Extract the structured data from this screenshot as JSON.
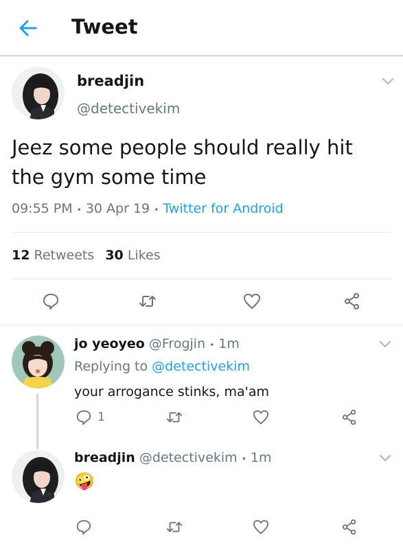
{
  "header": {
    "title": "Tweet"
  },
  "main_tweet": {
    "display_name": "breadjin",
    "handle": "@detectivekim",
    "text_line1": "Jeez some people should really hit",
    "text_line2": "the gym some time",
    "time": "09:55 PM",
    "date": "30 Apr 19",
    "sep": "•",
    "source": "Twitter for Android",
    "retweets_count": "12",
    "retweets_label": "Retweets",
    "likes_count": "30",
    "likes_label": "Likes"
  },
  "replies": [
    {
      "display_name": "jo yeoyeo",
      "handle": "@Frogjin",
      "sep": "•",
      "time": "1m",
      "replying_prefix": "Replying to",
      "replying_handle": "@detectivekim",
      "text": "your arrogance stinks, ma'am",
      "reply_count": "1"
    },
    {
      "display_name": "breadjin",
      "handle": "@detectivekim",
      "sep": "•",
      "time": "1m",
      "emoji": "🤪"
    }
  ],
  "colors": {
    "accent": "#1da1f2",
    "muted": "#657786",
    "icon": "#657786"
  }
}
